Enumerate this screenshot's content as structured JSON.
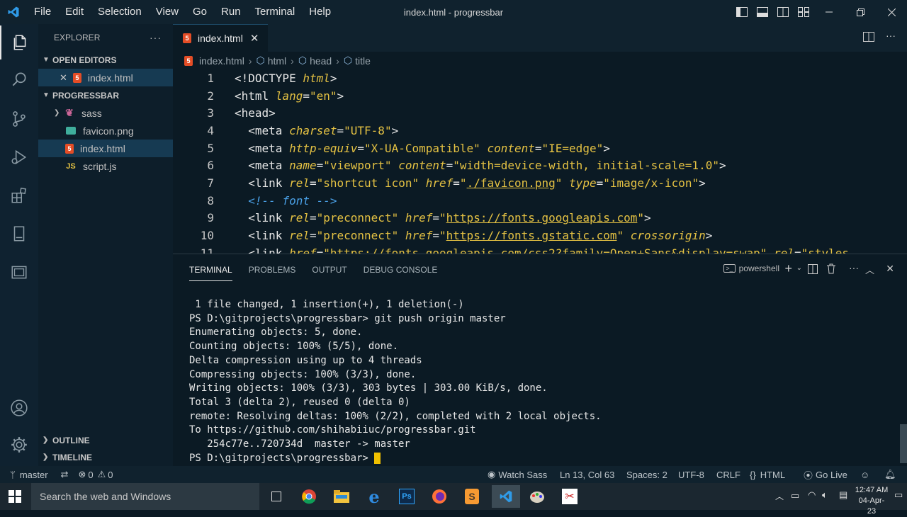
{
  "window": {
    "title": "index.html - progressbar"
  },
  "menu": [
    "File",
    "Edit",
    "Selection",
    "View",
    "Go",
    "Run",
    "Terminal",
    "Help"
  ],
  "sidebar": {
    "header": "EXPLORER",
    "open_editors_label": "OPEN EDITORS",
    "open_editors": [
      {
        "name": "index.html"
      }
    ],
    "project_label": "PROGRESSBAR",
    "files": [
      {
        "name": "sass",
        "type": "folder"
      },
      {
        "name": "favicon.png",
        "type": "image"
      },
      {
        "name": "index.html",
        "type": "html"
      },
      {
        "name": "script.js",
        "type": "js"
      }
    ],
    "outline_label": "OUTLINE",
    "timeline_label": "TIMELINE"
  },
  "editor": {
    "tab": {
      "name": "index.html"
    },
    "breadcrumb": [
      "index.html",
      "html",
      "head",
      "title"
    ],
    "lines": [
      {
        "n": "1"
      },
      {
        "n": "2"
      },
      {
        "n": "3"
      },
      {
        "n": "4"
      },
      {
        "n": "5"
      },
      {
        "n": "6"
      },
      {
        "n": "7"
      },
      {
        "n": "8"
      },
      {
        "n": "9"
      },
      {
        "n": "10"
      },
      {
        "n": "11"
      }
    ]
  },
  "panel": {
    "tabs": [
      "TERMINAL",
      "PROBLEMS",
      "OUTPUT",
      "DEBUG CONSOLE"
    ],
    "shell": "powershell",
    "terminal_lines": [
      " 1 file changed, 1 insertion(+), 1 deletion(-)",
      "PS D:\\gitprojects\\progressbar> git push origin master",
      "Enumerating objects: 5, done.",
      "Counting objects: 100% (5/5), done.",
      "Delta compression using up to 4 threads",
      "Compressing objects: 100% (3/3), done.",
      "Writing objects: 100% (3/3), 303 bytes | 303.00 KiB/s, done.",
      "Total 3 (delta 2), reused 0 (delta 0)",
      "remote: Resolving deltas: 100% (2/2), completed with 2 local objects.",
      "To https://github.com/shihabiiuc/progressbar.git",
      "   254c77e..720734d  master -> master",
      "PS D:\\gitprojects\\progressbar> "
    ]
  },
  "statusbar": {
    "branch": "master",
    "errors": "0",
    "warnings": "0",
    "watch_sass": "Watch Sass",
    "position": "Ln 13, Col 63",
    "spaces": "Spaces: 2",
    "encoding": "UTF-8",
    "eol": "CRLF",
    "language": "HTML",
    "go_live": "Go Live"
  },
  "taskbar": {
    "search_placeholder": "Search the web and Windows",
    "time": "12:47 AM",
    "date": "04-Apr-23"
  },
  "colors": {
    "accent": "#e5c243",
    "comment": "#4aa0e6",
    "background": "#0b1a24"
  }
}
